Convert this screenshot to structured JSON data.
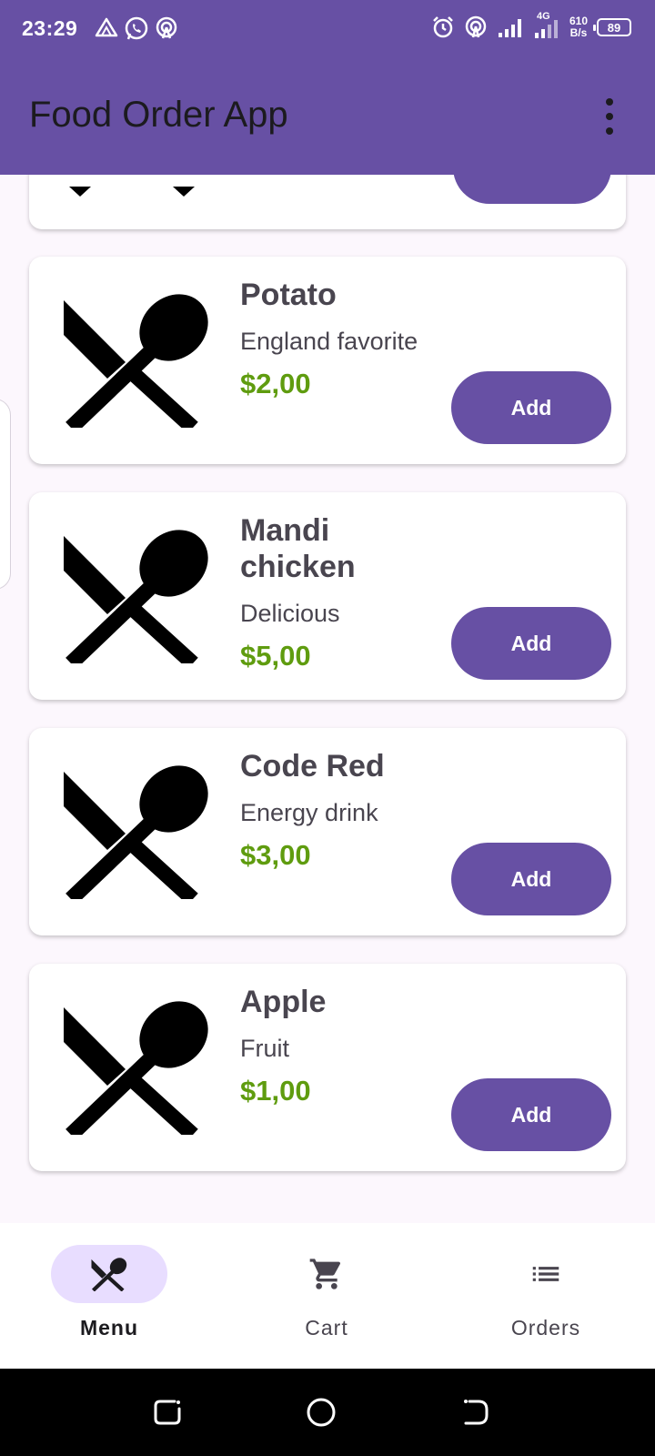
{
  "status_bar": {
    "time": "23:29",
    "net_speed_value": "610",
    "net_speed_unit": "B/s",
    "network_type": "4G",
    "battery": "89",
    "left_icons": [
      "drive-icon",
      "whatsapp-icon",
      "hotspot-icon"
    ],
    "right_icons": [
      "alarm-icon",
      "hotspot-icon",
      "signal-icon",
      "signal-icon"
    ]
  },
  "app_bar": {
    "title": "Food Order App",
    "menu_icon": "more-vert-icon"
  },
  "menu": {
    "add_label": "Add",
    "item_icon": "restaurant-icon",
    "items": [
      {
        "name": "Potato",
        "description": "England favorite",
        "price": "$2,00"
      },
      {
        "name": "Mandi chicken",
        "description": "Delicious",
        "price": "$5,00"
      },
      {
        "name": "Code Red",
        "description": "Energy drink",
        "price": "$3,00"
      },
      {
        "name": "Apple",
        "description": "Fruit",
        "price": "$1,00"
      }
    ]
  },
  "bottom_nav": {
    "items": [
      {
        "label": "Menu",
        "icon": "restaurant-icon",
        "active": true
      },
      {
        "label": "Cart",
        "icon": "cart-icon",
        "active": false
      },
      {
        "label": "Orders",
        "icon": "list-icon",
        "active": false
      }
    ]
  },
  "system_nav": {
    "buttons": [
      "recents-icon",
      "home-icon",
      "back-icon"
    ]
  },
  "colors": {
    "primary": "#6750a4",
    "price": "#5f9c0f",
    "nav_active": "#e8ddff",
    "text": "#49454f"
  }
}
